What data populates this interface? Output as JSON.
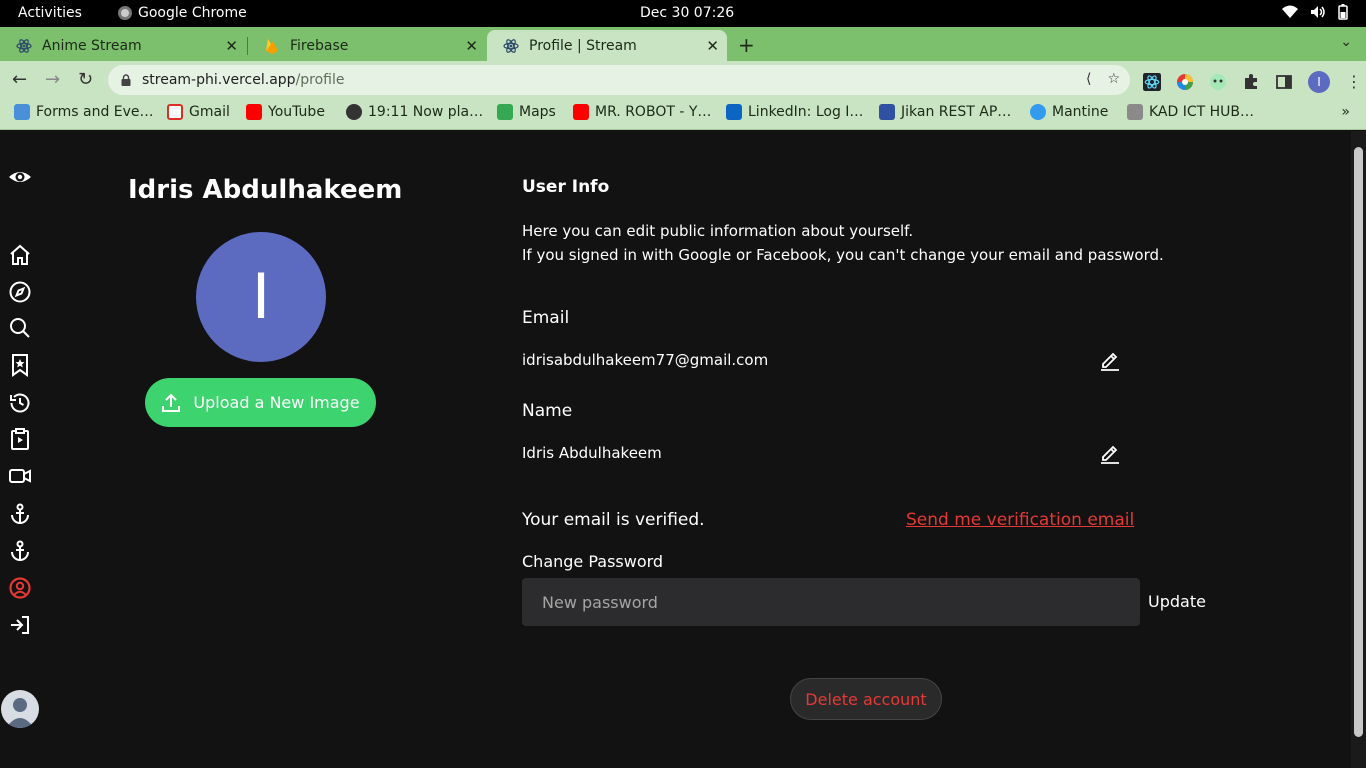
{
  "system_bar": {
    "activities": "Activities",
    "app_name": "Google Chrome",
    "clock": "Dec 30  07:26"
  },
  "tabs": [
    {
      "label": "Anime Stream",
      "icon": "react-icon"
    },
    {
      "label": "Firebase",
      "icon": "firebase-icon"
    },
    {
      "label": "Profile | Stream",
      "icon": "react-icon",
      "active": true
    }
  ],
  "address_bar": {
    "host": "stream-phi.vercel.app",
    "path": "/profile"
  },
  "bookmarks": [
    {
      "label": "Forms and Eve…",
      "icon": "forms-icon",
      "color": "#4a90d9"
    },
    {
      "label": "Gmail",
      "icon": "gmail-icon",
      "color": "#d93025"
    },
    {
      "label": "YouTube",
      "icon": "youtube-icon",
      "color": "#ff0000"
    },
    {
      "label": "19:11 Now pla…",
      "icon": "globe-icon",
      "color": "#333333"
    },
    {
      "label": "Maps",
      "icon": "maps-icon",
      "color": "#34a853"
    },
    {
      "label": "MR. ROBOT - Y…",
      "icon": "youtube-icon",
      "color": "#ff0000"
    },
    {
      "label": "LinkedIn: Log I…",
      "icon": "linkedin-icon",
      "color": "#0a66c2"
    },
    {
      "label": "Jikan REST AP…",
      "icon": "jikan-icon",
      "color": "#2e51a2"
    },
    {
      "label": "Mantine",
      "icon": "mantine-icon",
      "color": "#339af0"
    },
    {
      "label": "KAD ICT HUB…",
      "icon": "kad-icon",
      "color": "#8a8a8a"
    }
  ],
  "profile": {
    "name": "Idris Abdulhakeem",
    "avatar_initial": "I",
    "upload_label": "Upload a New Image"
  },
  "user_info": {
    "title": "User Info",
    "desc_line1": "Here you can edit public information about yourself.",
    "desc_line2": "If you signed in with Google or Facebook, you can't change your email and password.",
    "email_label": "Email",
    "email_value": "idrisabdulhakeem77@gmail.com",
    "name_label": "Name",
    "name_value": "Idris Abdulhakeem",
    "verified_text": "Your email is verified.",
    "send_verification": "Send me verification email",
    "password_label": "Change Password",
    "password_placeholder": "New password",
    "update_label": "Update",
    "delete_label": "Delete account"
  },
  "colors": {
    "accent_green": "#3dd36e",
    "avatar_blue": "#5c6bc0",
    "danger_red": "#e53935",
    "tab_bar": "#7cbf6d"
  }
}
